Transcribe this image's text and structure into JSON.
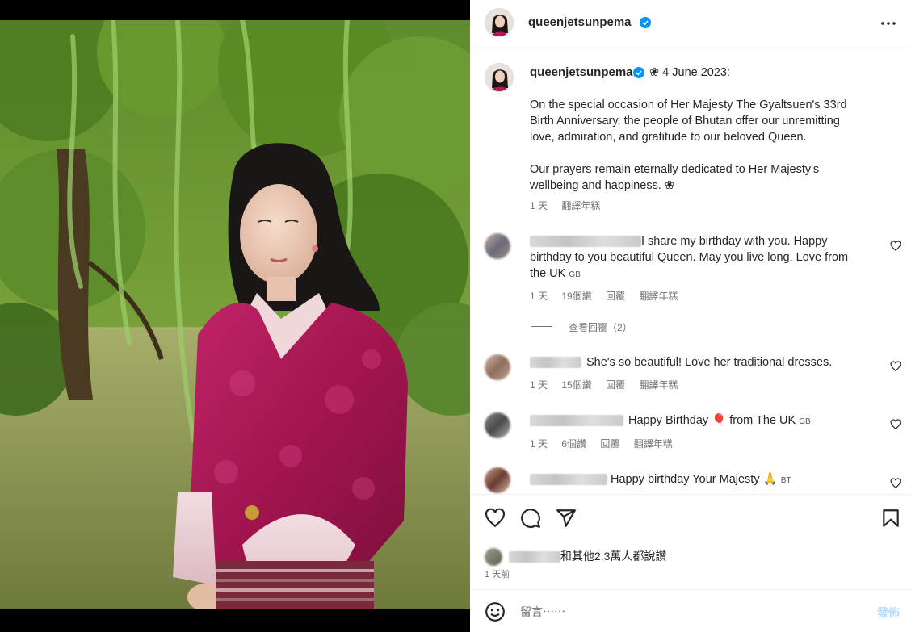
{
  "post": {
    "username": "queenjetsunpema",
    "caption_date": "❀ 4 June 2023:",
    "caption_lines": [
      "On the special occasion of Her Majesty The Gyaltsuen's 33rd",
      "Birth Anniversary, the people of Bhutan offer our unremitting",
      "love, admiration, and gratitude to our beloved Queen."
    ],
    "caption_lines2": [
      "Our prayers remain eternally dedicated to Her Majesty's",
      "wellbeing and happiness. ❀"
    ],
    "caption_time": "1 天",
    "caption_translate": "翻譯年糕"
  },
  "comments": [
    {
      "text_lines": [
        "I share my birthday with you. Happy",
        "birthday to you beautiful Queen. May you live long. Love from",
        "the UK "
      ],
      "flag": "GB",
      "time": "1 天",
      "likes": "19個讚",
      "reply": "回覆",
      "translate": "翻譯年糕",
      "view_replies": "查看回覆（2）"
    },
    {
      "text": "She's so beautiful! Love her traditional dresses.",
      "time": "1 天",
      "likes": "15個讚",
      "reply": "回覆",
      "translate": "翻譯年糕"
    },
    {
      "text_before": "Happy Birthday ",
      "emoji": "🎈",
      "text_after": " from The UK ",
      "flag": "GB",
      "time": "1 天",
      "likes": "6個讚",
      "reply": "回覆",
      "translate": "翻譯年糕"
    },
    {
      "text": "Happy birthday Your Majesty 🙏",
      "flag": "BT"
    }
  ],
  "footer": {
    "likes_text": "和其他2.3萬人都說讚",
    "time_ago": "1 天前",
    "comment_placeholder": "留言⋯⋯",
    "post_label": "發佈"
  },
  "icons": {
    "more": "more-options-icon",
    "verified": "verified-badge-icon",
    "heart": "heart-icon",
    "comment": "comment-icon",
    "share": "share-icon",
    "save": "bookmark-icon",
    "emoji": "emoji-icon"
  },
  "colors": {
    "verified": "#0095f6",
    "text": "#262626",
    "muted": "#737373",
    "post_disabled": "#b3dbff",
    "robe": "#b0185a"
  }
}
